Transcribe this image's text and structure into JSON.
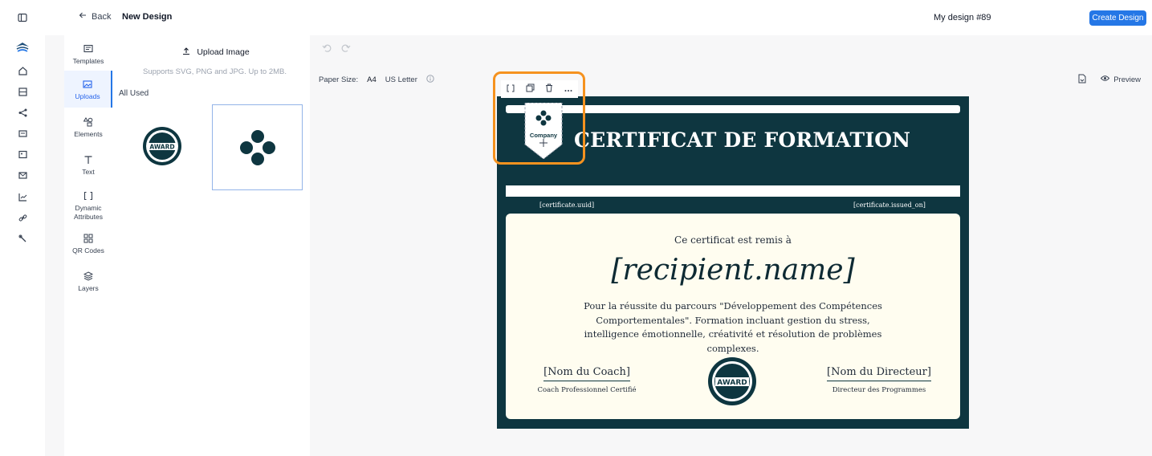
{
  "header": {
    "back_label": "Back",
    "title": "New Design",
    "design_name": "My design #89",
    "create_label": "Create Design"
  },
  "rail": {
    "icons": [
      "panel-toggle-icon",
      "logo-icon",
      "home-icon",
      "grid-icon",
      "share-icon",
      "mail-icon",
      "image-icon",
      "envelope-icon",
      "chart-icon",
      "link-icon",
      "tools-icon"
    ]
  },
  "tools": [
    {
      "label": "Templates",
      "icon": "templates-icon"
    },
    {
      "label": "Uploads",
      "icon": "image-icon",
      "active": true
    },
    {
      "label": "Elements",
      "icon": "shapes-icon"
    },
    {
      "label": "Text",
      "icon": "text-icon"
    },
    {
      "label": "Dynamic\nAttributes",
      "icon": "brackets-icon"
    },
    {
      "label": "QR Codes",
      "icon": "qr-icon"
    },
    {
      "label": "Layers",
      "icon": "layers-icon"
    }
  ],
  "uploads": {
    "button_label": "Upload Image",
    "support_text": "Supports SVG, PNG and JPG. Up to 2MB.",
    "filter_label": "All Used",
    "award_text": "AWARD"
  },
  "canvas": {
    "paper_size_label": "Paper Size:",
    "paper_a4": "A4",
    "paper_us_letter": "US Letter",
    "preview_label": "Preview"
  },
  "certificate": {
    "title": "CERTIFICAT DE FORMATION",
    "uuid": "[certificate.uuid]",
    "issued_on": "[certificate.issued_on]",
    "remis": "Ce certificat est remis à",
    "recipient": "[recipient.name]",
    "description": "Pour la réussite du parcours \"Développement des Compétences Comportementales\". Formation incluant gestion du stress, intelligence émotionnelle, créativité et résolution de problèmes complexes.",
    "coach_name": "[Nom du Coach]",
    "coach_role": "Coach Professionnel Certifié",
    "director_name": "[Nom du Directeur]",
    "director_role": "Directeur des Programmes",
    "seal_text": "AWARD",
    "logo_text": "Company"
  },
  "colors": {
    "accent": "#2577e6",
    "certificate_bg": "#0e3640",
    "certificate_card": "#fffdf0",
    "selection": "#f5921f"
  }
}
